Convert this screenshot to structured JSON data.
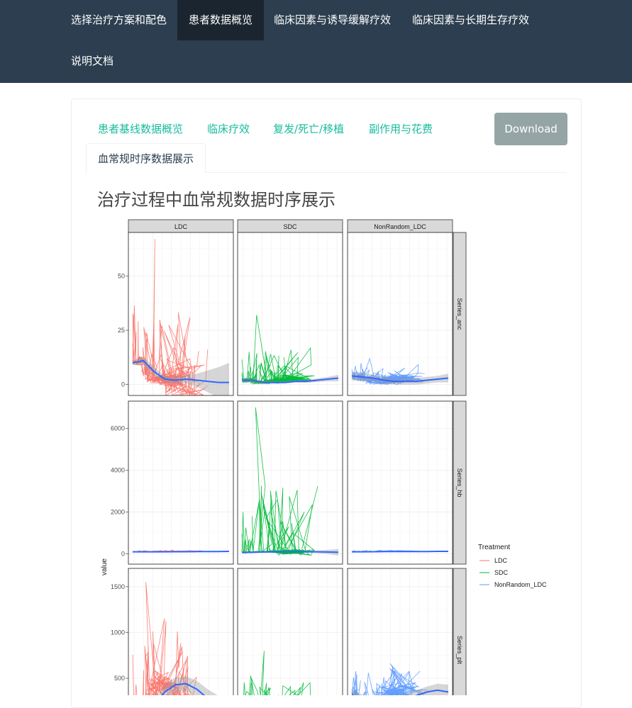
{
  "nav": {
    "items": [
      {
        "label": "选择治疗方案和配色",
        "active": false
      },
      {
        "label": "患者数据概览",
        "active": true
      },
      {
        "label": "临床因素与诱导缓解疗效",
        "active": false
      },
      {
        "label": "临床因素与长期生存疗效",
        "active": false
      },
      {
        "label": "说明文档",
        "active": false
      }
    ]
  },
  "tabs": {
    "items": [
      {
        "label": "患者基线数据概览"
      },
      {
        "label": "临床疗效"
      },
      {
        "label": "复发/死亡/移植"
      },
      {
        "label": "副作用与花费"
      },
      {
        "label": "血常规时序数据展示"
      }
    ],
    "active_index": 4
  },
  "download_label": "Download",
  "plot": {
    "title": "治疗过程中血常规数据时序展示"
  },
  "chart_data": {
    "type": "line",
    "facet_columns": [
      "LDC",
      "SDC",
      "NonRandom_LDC"
    ],
    "facet_rows": [
      "Series_anc",
      "Series_hb",
      "Series_plt"
    ],
    "ylabel": "value",
    "xlabel": "",
    "legend": {
      "title": "Treatment",
      "placement": "right",
      "entries": [
        {
          "name": "LDC",
          "color": "#f8766d"
        },
        {
          "name": "SDC",
          "color": "#00ba38"
        },
        {
          "name": "NonRandom_LDC",
          "color": "#619cff"
        }
      ]
    },
    "smooth_color": "#3366ff",
    "rows": [
      {
        "name": "Series_anc",
        "ylim": [
          -5,
          70
        ],
        "yticks": [
          0,
          25,
          50
        ],
        "ytick_labels": [
          "0",
          "25",
          "50"
        ],
        "panels": [
          {
            "column": "LDC",
            "peak": 67,
            "smooth": [
              10,
              11,
              6,
              2.5,
              2,
              2.5,
              2,
              1.5,
              1,
              1
            ],
            "ribbon": [
              1,
              2,
              2,
              1.5,
              1.5,
              2,
              3,
              5,
              7,
              9
            ]
          },
          {
            "column": "SDC",
            "peak": 32,
            "smooth": [
              2,
              2,
              1,
              1,
              1,
              1.5,
              1.5,
              2,
              2.5,
              3
            ],
            "ribbon": [
              1,
              1,
              0.8,
              0.6,
              0.6,
              0.6,
              0.7,
              0.8,
              1,
              1.5
            ]
          },
          {
            "column": "NonRandom_LDC",
            "peak": 12,
            "smooth": [
              4,
              3.5,
              3,
              2,
              1.5,
              1.5,
              1.5,
              2,
              2.5,
              3
            ],
            "ribbon": [
              2,
              2,
              1.5,
              1.5,
              1.5,
              1.5,
              1.5,
              1.5,
              1.5,
              2
            ]
          }
        ]
      },
      {
        "name": "Series_hb",
        "ylim": [
          -500,
          7300
        ],
        "yticks": [
          0,
          2000,
          4000,
          6000
        ],
        "ytick_labels": [
          "0",
          "2000",
          "4000",
          "6000"
        ],
        "panels": [
          {
            "column": "LDC",
            "peak": 130,
            "smooth": [
              90,
              90,
              90,
              90,
              95,
              95,
              100,
              100,
              105,
              110
            ],
            "ribbon": [
              20,
              20,
              20,
              20,
              20,
              20,
              20,
              20,
              25,
              30
            ]
          },
          {
            "column": "SDC",
            "peak": 7000,
            "smooth": [
              60,
              70,
              80,
              90,
              90,
              90,
              90,
              90,
              80,
              70
            ],
            "ribbon": [
              40,
              30,
              30,
              30,
              30,
              30,
              40,
              60,
              100,
              160
            ]
          },
          {
            "column": "NonRandom_LDC",
            "peak": 120,
            "smooth": [
              90,
              90,
              95,
              100,
              100,
              100,
              100,
              105,
              110,
              110
            ],
            "ribbon": [
              15,
              15,
              15,
              15,
              15,
              15,
              15,
              15,
              15,
              15
            ]
          }
        ]
      },
      {
        "name": "Series_plt",
        "ylim": [
          -80,
          1700
        ],
        "yticks": [
          500,
          1000,
          1500
        ],
        "ytick_labels": [
          "500",
          "1000",
          "1500"
        ],
        "panels": [
          {
            "column": "LDC",
            "peak": 1550,
            "smooth": [
              50,
              100,
              200,
              350,
              430,
              440,
              380,
              280,
              200,
              150
            ],
            "ribbon": [
              60,
              60,
              60,
              70,
              80,
              80,
              90,
              100,
              110,
              130
            ]
          },
          {
            "column": "SDC",
            "peak": 800,
            "smooth": [
              200,
              180,
              150,
              130,
              120,
              120,
              130,
              150,
              170,
              200
            ],
            "ribbon": [
              50,
              50,
              50,
              50,
              50,
              50,
              50,
              60,
              70,
              90
            ]
          },
          {
            "column": "NonRandom_LDC",
            "peak": 560,
            "smooth": [
              320,
              260,
              210,
              200,
              220,
              260,
              310,
              350,
              370,
              350
            ],
            "ribbon": [
              60,
              60,
              60,
              60,
              60,
              60,
              60,
              60,
              70,
              80
            ]
          }
        ]
      }
    ]
  }
}
